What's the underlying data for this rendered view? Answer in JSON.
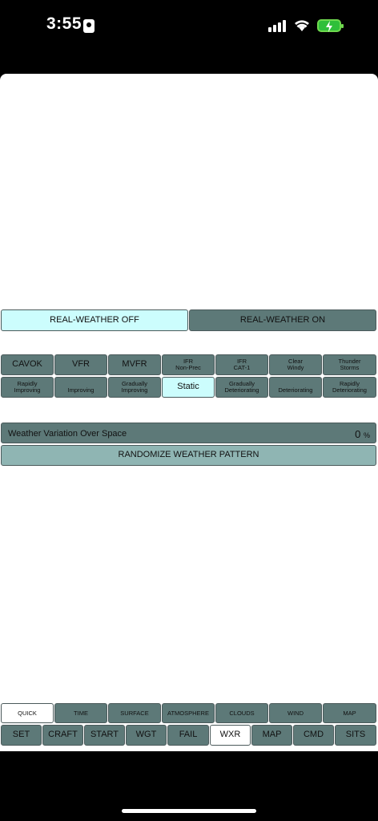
{
  "status_bar": {
    "time": "3:55"
  },
  "real_weather": {
    "off_label": "REAL-WEATHER  OFF",
    "on_label": "REAL-WEATHER  ON"
  },
  "presets": [
    [
      "CAVOK"
    ],
    [
      "VFR"
    ],
    [
      "MVFR"
    ],
    [
      "IFR",
      "Non-Prec"
    ],
    [
      "IFR",
      "CAT-1"
    ],
    [
      "Clear",
      "Windy"
    ],
    [
      "Thunder",
      "Storms"
    ]
  ],
  "trends": [
    [
      "Rapidly",
      "Improving"
    ],
    [
      "Improving"
    ],
    [
      "Gradually",
      "Improving"
    ],
    [
      "Static"
    ],
    [
      "Gradually",
      "Deteriorating"
    ],
    [
      "Deteriorating"
    ],
    [
      "Rapidly",
      "Deteriorating"
    ]
  ],
  "variation": {
    "label": "Weather  Variation  Over  Space",
    "value": "0",
    "unit": "%"
  },
  "randomize_label": "RANDOMIZE  WEATHER  PATTERN",
  "sub_tabs": [
    "QUICK",
    "TIME",
    "SURFACE",
    "ATMOSPHERE",
    "CLOUDS",
    "WIND",
    "MAP"
  ],
  "nav_tabs": [
    "SET",
    "CRAFT",
    "START",
    "WGT",
    "FAIL",
    "WXR",
    "MAP",
    "CMD",
    "SITS"
  ],
  "colors": {
    "active": "#ccfdfd",
    "button": "#5d7978",
    "light_button": "#8fb5b3"
  }
}
